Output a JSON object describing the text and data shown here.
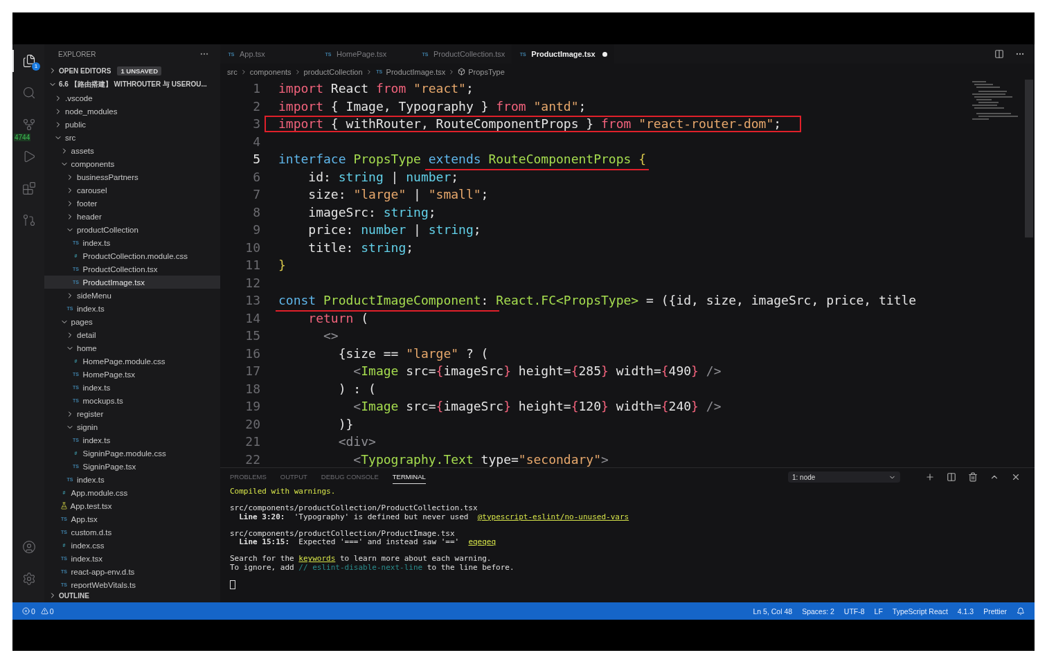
{
  "activity_bar": {
    "items": [
      {
        "kind": "files",
        "selected": true,
        "badge": "1"
      },
      {
        "kind": "search",
        "selected": false
      },
      {
        "kind": "source_control",
        "selected": false,
        "badge": "4744"
      },
      {
        "kind": "run",
        "selected": false
      },
      {
        "kind": "extensions",
        "selected": false
      },
      {
        "kind": "remote",
        "selected": false
      }
    ],
    "bottom": [
      {
        "kind": "account"
      },
      {
        "kind": "settings"
      }
    ]
  },
  "explorer": {
    "title": "EXPLORER",
    "open_editors": {
      "label": "OPEN EDITORS",
      "expanded": false,
      "badge": "1 UNSAVED"
    },
    "project": {
      "label": "6.6 【路由搭建】 WITHROUTER 与 USEROU...",
      "expanded": true
    },
    "tree": [
      {
        "name": ".vscode",
        "kind": "folder",
        "expanded": false,
        "selected": false
      },
      {
        "name": "node_modules",
        "kind": "folder",
        "expanded": false,
        "selected": false
      },
      {
        "name": "public",
        "kind": "folder",
        "expanded": false,
        "selected": false
      },
      {
        "name": "src",
        "kind": "folder",
        "expanded": true,
        "selected": false,
        "children": [
          {
            "name": "assets",
            "kind": "folder",
            "expanded": false,
            "selected": false
          },
          {
            "name": "components",
            "kind": "folder",
            "expanded": true,
            "selected": false,
            "children": [
              {
                "name": "businessPartners",
                "kind": "folder",
                "expanded": false,
                "selected": false
              },
              {
                "name": "carousel",
                "kind": "folder",
                "expanded": false,
                "selected": false
              },
              {
                "name": "footer",
                "kind": "folder",
                "expanded": false,
                "selected": false
              },
              {
                "name": "header",
                "kind": "folder",
                "expanded": false,
                "selected": false
              },
              {
                "name": "productCollection",
                "kind": "folder",
                "expanded": true,
                "selected": false,
                "children": [
                  {
                    "name": "index.ts",
                    "kind": "ts",
                    "glyph": "TS",
                    "selected": false
                  },
                  {
                    "name": "ProductCollection.module.css",
                    "kind": "css",
                    "glyph": "#",
                    "selected": false
                  },
                  {
                    "name": "ProductCollection.tsx",
                    "kind": "ts",
                    "glyph": "TS",
                    "selected": false
                  },
                  {
                    "name": "ProductImage.tsx",
                    "kind": "ts",
                    "glyph": "TS",
                    "selected": true
                  }
                ]
              },
              {
                "name": "sideMenu",
                "kind": "folder",
                "expanded": false,
                "selected": false
              },
              {
                "name": "index.ts",
                "kind": "ts",
                "glyph": "TS",
                "selected": false
              }
            ]
          },
          {
            "name": "pages",
            "kind": "folder",
            "expanded": true,
            "selected": false,
            "children": [
              {
                "name": "detail",
                "kind": "folder",
                "expanded": false,
                "selected": false
              },
              {
                "name": "home",
                "kind": "folder",
                "expanded": true,
                "selected": false,
                "children": [
                  {
                    "name": "HomePage.module.css",
                    "kind": "css",
                    "glyph": "#",
                    "selected": false
                  },
                  {
                    "name": "HomePage.tsx",
                    "kind": "ts",
                    "glyph": "TS",
                    "selected": false
                  },
                  {
                    "name": "index.ts",
                    "kind": "ts",
                    "glyph": "TS",
                    "selected": false
                  },
                  {
                    "name": "mockups.ts",
                    "kind": "ts",
                    "glyph": "TS",
                    "selected": false
                  }
                ]
              },
              {
                "name": "register",
                "kind": "folder",
                "expanded": false,
                "selected": false
              },
              {
                "name": "signin",
                "kind": "folder",
                "expanded": true,
                "selected": false,
                "children": [
                  {
                    "name": "index.ts",
                    "kind": "ts",
                    "glyph": "TS",
                    "selected": false
                  },
                  {
                    "name": "SigninPage.module.css",
                    "kind": "css",
                    "glyph": "#",
                    "selected": false
                  },
                  {
                    "name": "SigninPage.tsx",
                    "kind": "ts",
                    "glyph": "TS",
                    "selected": false
                  }
                ]
              },
              {
                "name": "index.ts",
                "kind": "ts",
                "glyph": "TS",
                "selected": false
              }
            ]
          },
          {
            "name": "App.module.css",
            "kind": "css",
            "glyph": "#",
            "selected": false
          },
          {
            "name": "App.test.tsx",
            "kind": "test",
            "selected": false
          },
          {
            "name": "App.tsx",
            "kind": "ts",
            "glyph": "TS",
            "selected": false
          },
          {
            "name": "custom.d.ts",
            "kind": "ts",
            "glyph": "TS",
            "selected": false
          },
          {
            "name": "index.css",
            "kind": "css",
            "glyph": "#",
            "selected": false
          },
          {
            "name": "index.tsx",
            "kind": "ts",
            "glyph": "TS",
            "selected": false
          },
          {
            "name": "react-app-env.d.ts",
            "kind": "ts",
            "glyph": "TS",
            "selected": false
          },
          {
            "name": "reportWebVitals.ts",
            "kind": "ts",
            "glyph": "TS",
            "selected": false
          }
        ]
      }
    ],
    "outline": {
      "label": "OUTLINE",
      "expanded": false
    }
  },
  "tabs": [
    {
      "label": "App.tsx",
      "glyph": "TS",
      "selected": false,
      "modified": false
    },
    {
      "label": "HomePage.tsx",
      "glyph": "TS",
      "selected": false,
      "modified": false
    },
    {
      "label": "ProductCollection.tsx",
      "glyph": "TS",
      "selected": false,
      "modified": false
    },
    {
      "label": "ProductImage.tsx",
      "glyph": "TS",
      "selected": true,
      "modified": true
    }
  ],
  "breadcrumb": [
    {
      "label": "src",
      "kind": "folder"
    },
    {
      "label": "components",
      "kind": "folder"
    },
    {
      "label": "productCollection",
      "kind": "folder"
    },
    {
      "label": "ProductImage.tsx",
      "kind": "file",
      "glyph": "TS"
    },
    {
      "label": "PropsType",
      "kind": "symbol"
    }
  ],
  "editor": {
    "lines": [
      {
        "number": "1",
        "current": false,
        "kind": "plain",
        "tokens": [
          {
            "kind": "kw",
            "text": "import"
          },
          {
            "kind": "plain",
            "text": " React "
          },
          {
            "kind": "kw",
            "text": "from"
          },
          {
            "kind": "str",
            "text": " \"react\""
          },
          {
            "kind": "plain",
            "text": ";"
          }
        ]
      },
      {
        "number": "2",
        "current": false,
        "kind": "plain",
        "tokens": [
          {
            "kind": "kw",
            "text": "import"
          },
          {
            "kind": "plain",
            "text": " { Image, Typography } "
          },
          {
            "kind": "kw",
            "text": "from"
          },
          {
            "kind": "str",
            "text": " \"antd\""
          },
          {
            "kind": "plain",
            "text": ";"
          }
        ]
      },
      {
        "number": "3",
        "current": false,
        "kind": "boxed",
        "tokens": [
          {
            "kind": "kw",
            "text": "import"
          },
          {
            "kind": "plain",
            "text": " { withRouter, RouteComponentProps } "
          },
          {
            "kind": "kw",
            "text": "from"
          },
          {
            "kind": "str",
            "text": " \"react-router-dom\""
          },
          {
            "kind": "plain",
            "text": ";"
          }
        ]
      },
      {
        "number": "4",
        "current": false,
        "kind": "plain"
      },
      {
        "number": "5",
        "current": true,
        "kind": "underlined",
        "tokens": [
          {
            "kind": "decl",
            "text": "interface ",
            "underlined": false
          },
          {
            "kind": "cls",
            "text": "PropsType ",
            "underlined": false
          },
          {
            "kind": "decl",
            "text": "extends ",
            "underlined": true
          },
          {
            "kind": "cls",
            "text": "RouteComponentProps",
            "underlined": true
          },
          {
            "kind": "brace",
            "text": " {",
            "underlined": true
          }
        ]
      },
      {
        "number": "6",
        "current": false,
        "kind": "plain",
        "tokens": [
          {
            "kind": "plain",
            "text": "    id: "
          },
          {
            "kind": "type",
            "text": "string"
          },
          {
            "kind": "plain",
            "text": " | "
          },
          {
            "kind": "type",
            "text": "number"
          },
          {
            "kind": "plain",
            "text": ";"
          }
        ]
      },
      {
        "number": "7",
        "current": false,
        "kind": "plain",
        "tokens": [
          {
            "kind": "plain",
            "text": "    size: "
          },
          {
            "kind": "str",
            "text": "\"large\""
          },
          {
            "kind": "plain",
            "text": " | "
          },
          {
            "kind": "str",
            "text": "\"small\""
          },
          {
            "kind": "plain",
            "text": ";"
          }
        ]
      },
      {
        "number": "8",
        "current": false,
        "kind": "plain",
        "tokens": [
          {
            "kind": "plain",
            "text": "    imageSrc: "
          },
          {
            "kind": "type",
            "text": "string"
          },
          {
            "kind": "plain",
            "text": ";"
          }
        ]
      },
      {
        "number": "9",
        "current": false,
        "kind": "plain",
        "tokens": [
          {
            "kind": "plain",
            "text": "    price: "
          },
          {
            "kind": "type",
            "text": "number"
          },
          {
            "kind": "plain",
            "text": " | "
          },
          {
            "kind": "type",
            "text": "string"
          },
          {
            "kind": "plain",
            "text": ";"
          }
        ]
      },
      {
        "number": "10",
        "current": false,
        "kind": "plain",
        "tokens": [
          {
            "kind": "plain",
            "text": "    title: "
          },
          {
            "kind": "type",
            "text": "string"
          },
          {
            "kind": "plain",
            "text": ";"
          }
        ]
      },
      {
        "number": "11",
        "current": false,
        "kind": "plain",
        "tokens": [
          {
            "kind": "brace",
            "text": "}"
          }
        ]
      },
      {
        "number": "12",
        "current": false,
        "kind": "plain"
      },
      {
        "number": "13",
        "current": false,
        "kind": "underlined",
        "tokens": [
          {
            "kind": "decl",
            "text": "const ",
            "underlined": true
          },
          {
            "kind": "cls",
            "text": "ProductImageComponent",
            "underlined": true
          },
          {
            "kind": "plain",
            "text": ": ",
            "underlined": true
          },
          {
            "kind": "cls",
            "text": "React.FC<PropsType>",
            "underlined": false
          },
          {
            "kind": "plain",
            "text": " = ({id, size, imageSrc, price, title",
            "underlined": false
          }
        ]
      },
      {
        "number": "14",
        "current": false,
        "kind": "plain",
        "tokens": [
          {
            "kind": "kw",
            "text": "    return"
          },
          {
            "kind": "plain",
            "text": " ("
          }
        ]
      },
      {
        "number": "15",
        "current": false,
        "kind": "plain",
        "tokens": [
          {
            "kind": "punc",
            "text": "      <>"
          }
        ]
      },
      {
        "number": "16",
        "current": false,
        "kind": "plain",
        "tokens": [
          {
            "kind": "plain",
            "text": "        {size == "
          },
          {
            "kind": "str",
            "text": "\"large\""
          },
          {
            "kind": "plain",
            "text": " ? ("
          }
        ]
      },
      {
        "number": "17",
        "current": false,
        "kind": "plain",
        "tokens": [
          {
            "kind": "punc",
            "text": "          <"
          },
          {
            "kind": "cls",
            "text": "Image"
          },
          {
            "kind": "plain",
            "text": " src="
          },
          {
            "kind": "kw",
            "text": "{"
          },
          {
            "kind": "plain",
            "text": "imageSrc"
          },
          {
            "kind": "kw",
            "text": "}"
          },
          {
            "kind": "plain",
            "text": " height="
          },
          {
            "kind": "kw",
            "text": "{"
          },
          {
            "kind": "plain",
            "text": "285"
          },
          {
            "kind": "kw",
            "text": "}"
          },
          {
            "kind": "plain",
            "text": " width="
          },
          {
            "kind": "kw",
            "text": "{"
          },
          {
            "kind": "plain",
            "text": "490"
          },
          {
            "kind": "kw",
            "text": "}"
          },
          {
            "kind": "punc",
            "text": " />"
          }
        ]
      },
      {
        "number": "18",
        "current": false,
        "kind": "plain",
        "tokens": [
          {
            "kind": "plain",
            "text": "        ) : ("
          }
        ]
      },
      {
        "number": "19",
        "current": false,
        "kind": "plain",
        "tokens": [
          {
            "kind": "punc",
            "text": "          <"
          },
          {
            "kind": "cls",
            "text": "Image"
          },
          {
            "kind": "plain",
            "text": " src="
          },
          {
            "kind": "kw",
            "text": "{"
          },
          {
            "kind": "plain",
            "text": "imageSrc"
          },
          {
            "kind": "kw",
            "text": "}"
          },
          {
            "kind": "plain",
            "text": " height="
          },
          {
            "kind": "kw",
            "text": "{"
          },
          {
            "kind": "plain",
            "text": "120"
          },
          {
            "kind": "kw",
            "text": "}"
          },
          {
            "kind": "plain",
            "text": " width="
          },
          {
            "kind": "kw",
            "text": "{"
          },
          {
            "kind": "plain",
            "text": "240"
          },
          {
            "kind": "kw",
            "text": "}"
          },
          {
            "kind": "punc",
            "text": " />"
          }
        ]
      },
      {
        "number": "20",
        "current": false,
        "kind": "plain",
        "tokens": [
          {
            "kind": "plain",
            "text": "        )}"
          }
        ]
      },
      {
        "number": "21",
        "current": false,
        "kind": "plain",
        "tokens": [
          {
            "kind": "punc",
            "text": "        <div>"
          }
        ]
      },
      {
        "number": "22",
        "current": false,
        "kind": "plain",
        "tokens": [
          {
            "kind": "punc",
            "text": "          <"
          },
          {
            "kind": "cls",
            "text": "Typography.Text"
          },
          {
            "kind": "plain",
            "text": " type="
          },
          {
            "kind": "str",
            "text": "\"secondary\""
          },
          {
            "kind": "punc",
            "text": ">"
          }
        ]
      }
    ]
  },
  "panel": {
    "tabs": [
      {
        "label": "PROBLEMS",
        "selected": false
      },
      {
        "label": "OUTPUT",
        "selected": false
      },
      {
        "label": "DEBUG CONSOLE",
        "selected": false
      },
      {
        "label": "TERMINAL",
        "selected": true
      }
    ],
    "terminal_select": {
      "value": "1: node"
    },
    "terminal": {
      "blocks": [
        [
          [
            {
              "kind": "success",
              "text": "Compiled with warnings."
            }
          ]
        ],
        [
          [
            {
              "kind": "plain",
              "text": "src/components/productCollection/ProductCollection.tsx"
            }
          ],
          [
            {
              "kind": "bold",
              "text": "  Line 3:20:"
            },
            {
              "kind": "plain",
              "text": "  'Typography' is defined but never used  "
            },
            {
              "kind": "link",
              "text": "@typescript-eslint/no-unused-vars"
            }
          ]
        ],
        [
          [
            {
              "kind": "plain",
              "text": "src/components/productCollection/ProductImage.tsx"
            }
          ],
          [
            {
              "kind": "bold",
              "text": "  Line 15:15:"
            },
            {
              "kind": "plain",
              "text": "  Expected '===' and instead saw '=='  "
            },
            {
              "kind": "link",
              "text": "eqeqeq"
            }
          ]
        ],
        [
          [
            {
              "kind": "plain",
              "text": "Search for the "
            },
            {
              "kind": "link",
              "text": "keywords"
            },
            {
              "kind": "plain",
              "text": " to learn more about each warning."
            }
          ],
          [
            {
              "kind": "plain",
              "text": "To ignore, add "
            },
            {
              "kind": "comment",
              "text": "// eslint-disable-next-line"
            },
            {
              "kind": "plain",
              "text": " to the line before."
            }
          ]
        ]
      ]
    }
  },
  "status_bar": {
    "errors": "0",
    "warnings": "0",
    "items": [
      "Ln 5, Col 48",
      "Spaces: 2",
      "UTF-8",
      "LF",
      "TypeScript React",
      "4.1.3",
      "Prettier"
    ]
  }
}
